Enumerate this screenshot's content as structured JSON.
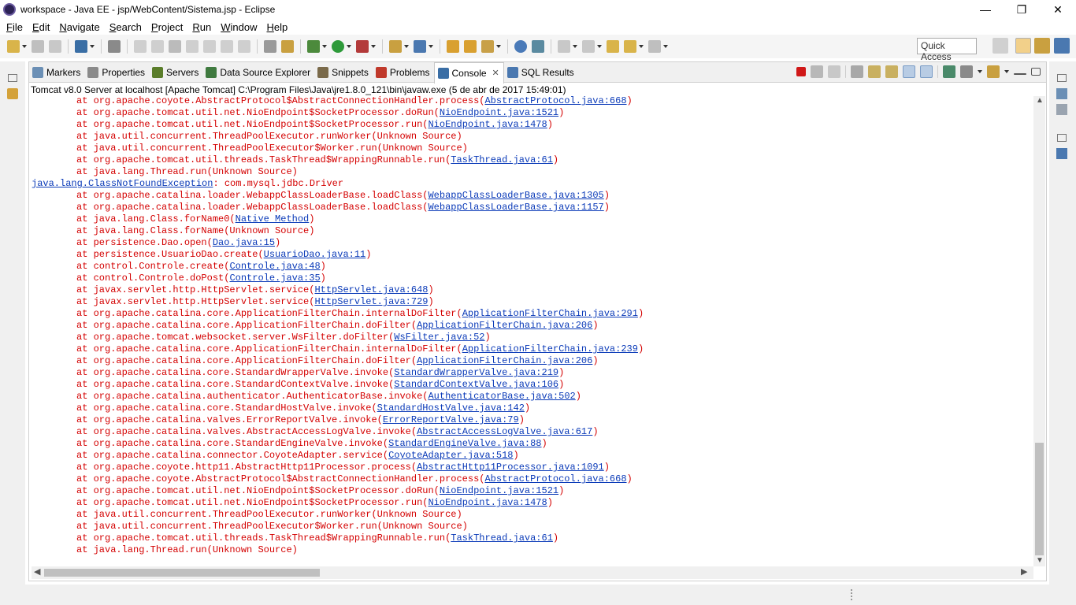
{
  "window": {
    "title": "workspace - Java EE - jsp/WebContent/Sistema.jsp - Eclipse",
    "minimize": "—",
    "maximize": "❐",
    "close": "✕"
  },
  "menu": [
    "File",
    "Edit",
    "Navigate",
    "Search",
    "Project",
    "Run",
    "Window",
    "Help"
  ],
  "quick_access": "Quick Access",
  "tabs": [
    {
      "label": "Markers",
      "icon": "markers-icon",
      "color": "#6b8fb5"
    },
    {
      "label": "Properties",
      "icon": "properties-icon",
      "color": "#8a8a8a"
    },
    {
      "label": "Servers",
      "icon": "servers-icon",
      "color": "#5a7d2a"
    },
    {
      "label": "Data Source Explorer",
      "icon": "data-source-icon",
      "color": "#3f7a3f"
    },
    {
      "label": "Snippets",
      "icon": "snippets-icon",
      "color": "#7a6a4a"
    },
    {
      "label": "Problems",
      "icon": "problems-icon",
      "color": "#c0392b"
    },
    {
      "label": "Console",
      "icon": "console-icon",
      "color": "#3a6ea5",
      "active": true,
      "close": "✕"
    },
    {
      "label": "SQL Results",
      "icon": "sql-results-icon",
      "color": "#4a78b0"
    }
  ],
  "console": {
    "label": "Tomcat v8.0 Server at localhost [Apache Tomcat] C:\\Program Files\\Java\\jre1.8.0_121\\bin\\javaw.exe (5 de abr de 2017 15:49:01)",
    "lines": [
      {
        "indent": true,
        "prefix": "at org.apache.coyote.AbstractProtocol$AbstractConnectionHandler.process(",
        "link": "AbstractProtocol.java:668",
        "suffix": ")"
      },
      {
        "indent": true,
        "prefix": "at org.apache.tomcat.util.net.NioEndpoint$SocketProcessor.doRun(",
        "link": "NioEndpoint.java:1521",
        "suffix": ")"
      },
      {
        "indent": true,
        "prefix": "at org.apache.tomcat.util.net.NioEndpoint$SocketProcessor.run(",
        "link": "NioEndpoint.java:1478",
        "suffix": ")"
      },
      {
        "indent": true,
        "prefix": "at java.util.concurrent.ThreadPoolExecutor.runWorker(Unknown Source)",
        "link": "",
        "suffix": ""
      },
      {
        "indent": true,
        "prefix": "at java.util.concurrent.ThreadPoolExecutor$Worker.run(Unknown Source)",
        "link": "",
        "suffix": ""
      },
      {
        "indent": true,
        "prefix": "at org.apache.tomcat.util.threads.TaskThread$WrappingRunnable.run(",
        "link": "TaskThread.java:61",
        "suffix": ")"
      },
      {
        "indent": true,
        "prefix": "at java.lang.Thread.run(Unknown Source)",
        "link": "",
        "suffix": ""
      },
      {
        "indent": false,
        "prefix": "",
        "link": "java.lang.ClassNotFoundException",
        "suffix": ": com.mysql.jdbc.Driver"
      },
      {
        "indent": true,
        "prefix": "at org.apache.catalina.loader.WebappClassLoaderBase.loadClass(",
        "link": "WebappClassLoaderBase.java:1305",
        "suffix": ")"
      },
      {
        "indent": true,
        "prefix": "at org.apache.catalina.loader.WebappClassLoaderBase.loadClass(",
        "link": "WebappClassLoaderBase.java:1157",
        "suffix": ")"
      },
      {
        "indent": true,
        "prefix": "at java.lang.Class.forName0(",
        "link": "Native Method",
        "suffix": ")"
      },
      {
        "indent": true,
        "prefix": "at java.lang.Class.forName(Unknown Source)",
        "link": "",
        "suffix": ""
      },
      {
        "indent": true,
        "prefix": "at persistence.Dao.open(",
        "link": "Dao.java:15",
        "suffix": ")"
      },
      {
        "indent": true,
        "prefix": "at persistence.UsuarioDao.create(",
        "link": "UsuarioDao.java:11",
        "suffix": ")"
      },
      {
        "indent": true,
        "prefix": "at control.Controle.create(",
        "link": "Controle.java:48",
        "suffix": ")"
      },
      {
        "indent": true,
        "prefix": "at control.Controle.doPost(",
        "link": "Controle.java:35",
        "suffix": ")"
      },
      {
        "indent": true,
        "prefix": "at javax.servlet.http.HttpServlet.service(",
        "link": "HttpServlet.java:648",
        "suffix": ")"
      },
      {
        "indent": true,
        "prefix": "at javax.servlet.http.HttpServlet.service(",
        "link": "HttpServlet.java:729",
        "suffix": ")"
      },
      {
        "indent": true,
        "prefix": "at org.apache.catalina.core.ApplicationFilterChain.internalDoFilter(",
        "link": "ApplicationFilterChain.java:291",
        "suffix": ")"
      },
      {
        "indent": true,
        "prefix": "at org.apache.catalina.core.ApplicationFilterChain.doFilter(",
        "link": "ApplicationFilterChain.java:206",
        "suffix": ")"
      },
      {
        "indent": true,
        "prefix": "at org.apache.tomcat.websocket.server.WsFilter.doFilter(",
        "link": "WsFilter.java:52",
        "suffix": ")"
      },
      {
        "indent": true,
        "prefix": "at org.apache.catalina.core.ApplicationFilterChain.internalDoFilter(",
        "link": "ApplicationFilterChain.java:239",
        "suffix": ")"
      },
      {
        "indent": true,
        "prefix": "at org.apache.catalina.core.ApplicationFilterChain.doFilter(",
        "link": "ApplicationFilterChain.java:206",
        "suffix": ")"
      },
      {
        "indent": true,
        "prefix": "at org.apache.catalina.core.StandardWrapperValve.invoke(",
        "link": "StandardWrapperValve.java:219",
        "suffix": ")"
      },
      {
        "indent": true,
        "prefix": "at org.apache.catalina.core.StandardContextValve.invoke(",
        "link": "StandardContextValve.java:106",
        "suffix": ")"
      },
      {
        "indent": true,
        "prefix": "at org.apache.catalina.authenticator.AuthenticatorBase.invoke(",
        "link": "AuthenticatorBase.java:502",
        "suffix": ")"
      },
      {
        "indent": true,
        "prefix": "at org.apache.catalina.core.StandardHostValve.invoke(",
        "link": "StandardHostValve.java:142",
        "suffix": ")"
      },
      {
        "indent": true,
        "prefix": "at org.apache.catalina.valves.ErrorReportValve.invoke(",
        "link": "ErrorReportValve.java:79",
        "suffix": ")"
      },
      {
        "indent": true,
        "prefix": "at org.apache.catalina.valves.AbstractAccessLogValve.invoke(",
        "link": "AbstractAccessLogValve.java:617",
        "suffix": ")"
      },
      {
        "indent": true,
        "prefix": "at org.apache.catalina.core.StandardEngineValve.invoke(",
        "link": "StandardEngineValve.java:88",
        "suffix": ")"
      },
      {
        "indent": true,
        "prefix": "at org.apache.catalina.connector.CoyoteAdapter.service(",
        "link": "CoyoteAdapter.java:518",
        "suffix": ")"
      },
      {
        "indent": true,
        "prefix": "at org.apache.coyote.http11.AbstractHttp11Processor.process(",
        "link": "AbstractHttp11Processor.java:1091",
        "suffix": ")"
      },
      {
        "indent": true,
        "prefix": "at org.apache.coyote.AbstractProtocol$AbstractConnectionHandler.process(",
        "link": "AbstractProtocol.java:668",
        "suffix": ")"
      },
      {
        "indent": true,
        "prefix": "at org.apache.tomcat.util.net.NioEndpoint$SocketProcessor.doRun(",
        "link": "NioEndpoint.java:1521",
        "suffix": ")"
      },
      {
        "indent": true,
        "prefix": "at org.apache.tomcat.util.net.NioEndpoint$SocketProcessor.run(",
        "link": "NioEndpoint.java:1478",
        "suffix": ")"
      },
      {
        "indent": true,
        "prefix": "at java.util.concurrent.ThreadPoolExecutor.runWorker(Unknown Source)",
        "link": "",
        "suffix": ""
      },
      {
        "indent": true,
        "prefix": "at java.util.concurrent.ThreadPoolExecutor$Worker.run(Unknown Source)",
        "link": "",
        "suffix": ""
      },
      {
        "indent": true,
        "prefix": "at org.apache.tomcat.util.threads.TaskThread$WrappingRunnable.run(",
        "link": "TaskThread.java:61",
        "suffix": ")"
      },
      {
        "indent": true,
        "prefix": "at java.lang.Thread.run(Unknown Source)",
        "link": "",
        "suffix": ""
      }
    ]
  },
  "colors": {
    "error_text": "#d40000",
    "link": "#0a3ab8",
    "terminate": "#d01818"
  }
}
